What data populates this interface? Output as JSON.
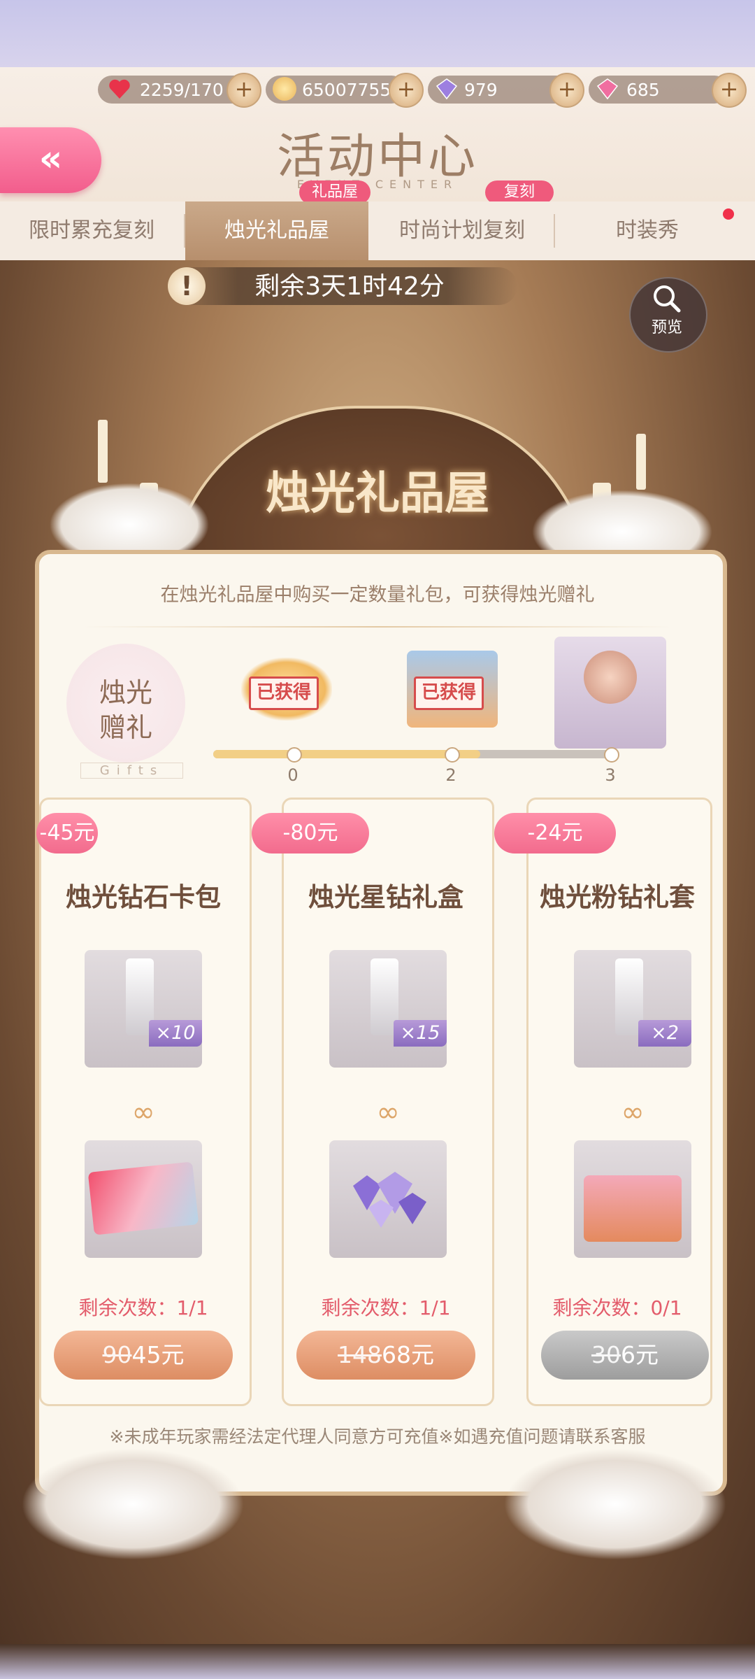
{
  "resources": [
    {
      "icon": "heart-icon",
      "value": "2259/170"
    },
    {
      "icon": "coin-icon",
      "value": "65007755"
    },
    {
      "icon": "purple-diamond-icon",
      "value": "979"
    },
    {
      "icon": "pink-diamond-icon",
      "value": "685"
    }
  ],
  "header": {
    "title": "活动中心",
    "subtitle": "EVENT CENTER",
    "back_glyph": "«"
  },
  "tabs": [
    {
      "label": "限时累充复刻",
      "badge": ""
    },
    {
      "label": "烛光礼品屋",
      "badge": "礼品屋",
      "active": true
    },
    {
      "label": "时尚计划复刻",
      "badge": "复刻"
    },
    {
      "label": "时装秀",
      "badge": ""
    }
  ],
  "timer": {
    "text": "剩余3天1时42分",
    "icon": "!"
  },
  "preview": {
    "label": "预览"
  },
  "event_title": "烛光礼品屋",
  "panel": {
    "description": "在烛光礼品屋中购买一定数量礼包，可获得烛光赠礼",
    "gift_title_line1": "烛光",
    "gift_title_line2": "赠礼",
    "gift_sub": "Gifts",
    "rewards": [
      {
        "status": "已获得",
        "threshold": "0"
      },
      {
        "status": "已获得",
        "threshold": "2"
      },
      {
        "status": "",
        "threshold": "3"
      }
    ],
    "progress_fraction": 0.67
  },
  "packs": [
    {
      "discount": "-45元",
      "title": "烛光钻石卡包",
      "qty": "×10",
      "remain": "剩余次数：1/1",
      "old_price": "90",
      "price": "45元",
      "available": true
    },
    {
      "discount": "-80元",
      "title": "烛光星钻礼盒",
      "qty": "×15",
      "remain": "剩余次数：1/1",
      "old_price": "148",
      "price": "68元",
      "available": true
    },
    {
      "discount": "-24元",
      "title": "烛光粉钻礼套",
      "qty": "×2",
      "remain": "剩余次数：0/1",
      "old_price": "30",
      "price": "6元",
      "available": false
    }
  ],
  "footer_note": "※未成年玩家需经法定代理人同意方可充值※如遇充值问题请联系客服",
  "colors": {
    "accent_pink": "#f26b8d",
    "gold": "#d8b88f",
    "text_brown": "#6f4f3c"
  }
}
